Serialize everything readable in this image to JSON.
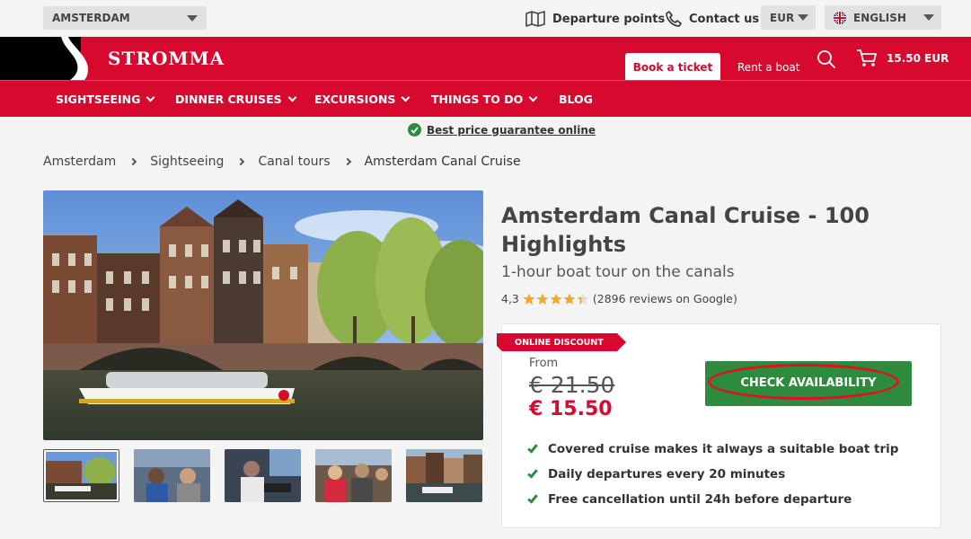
{
  "topbar": {
    "city": "AMSTERDAM",
    "departure_points": "Departure points",
    "contact_us": "Contact us",
    "currency": "EUR",
    "language": "ENGLISH"
  },
  "header": {
    "logo": "STROMMA",
    "book_ticket": "Book a ticket",
    "rent_boat": "Rent a boat",
    "cart_total": "15.50 EUR"
  },
  "nav": {
    "items": [
      {
        "label": "SIGHTSEEING"
      },
      {
        "label": "DINNER CRUISES"
      },
      {
        "label": "EXCURSIONS"
      },
      {
        "label": "THINGS TO DO"
      },
      {
        "label": "BLOG"
      }
    ]
  },
  "guarantee": "Best price guarantee online",
  "breadcrumb": [
    "Amsterdam",
    "Sightseeing",
    "Canal tours",
    "Amsterdam Canal Cruise"
  ],
  "product": {
    "title": "Amsterdam Canal Cruise - 100 Highlights",
    "subtitle": "1-hour boat tour on the canals",
    "rating_value": "4,3",
    "rating_stars": 4.3,
    "reviews": "(2896 reviews on Google)",
    "badge": "ONLINE DISCOUNT",
    "from_label": "From",
    "old_price": "€ 21.50",
    "new_price": "€ 15.50",
    "cta": "CHECK AVAILABILITY",
    "features": [
      "Covered cruise makes it always a suitable boat trip",
      "Daily departures every 20 minutes",
      "Free cancellation until 24h before departure"
    ]
  },
  "colors": {
    "brand_red": "#d8092f",
    "cta_green": "#2e8b3d"
  }
}
